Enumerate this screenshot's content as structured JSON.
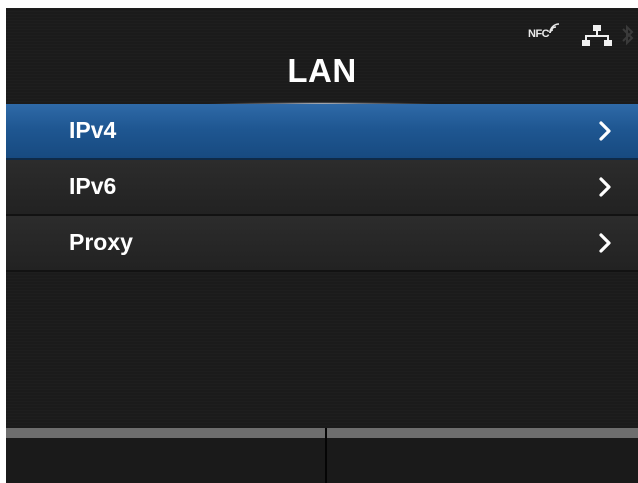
{
  "status": {
    "nfc_label": "NFC",
    "icons": [
      "nfc-icon",
      "lan-icon",
      "bluetooth-icon"
    ]
  },
  "header": {
    "title": "LAN"
  },
  "menu": {
    "selected_index": 0,
    "items": [
      {
        "label": "IPv4"
      },
      {
        "label": "IPv6"
      },
      {
        "label": "Proxy"
      }
    ]
  },
  "softkeys": {
    "left_label": "",
    "right_label": ""
  },
  "colors": {
    "background": "#1b1b1b",
    "selected": "#1f5792",
    "text": "#ffffff"
  }
}
